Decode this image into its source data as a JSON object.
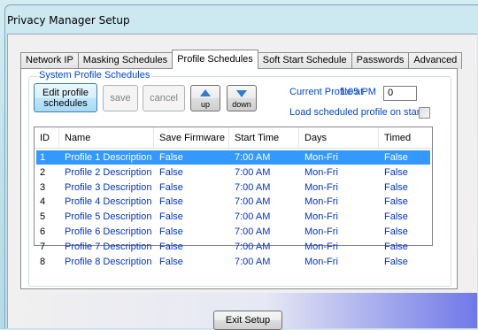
{
  "window": {
    "title": "Privacy Manager Setup"
  },
  "tabs": [
    {
      "label": "Network IP",
      "active": false
    },
    {
      "label": "Masking Schedules",
      "active": false
    },
    {
      "label": "Profile Schedules",
      "active": true
    },
    {
      "label": "Soft Start Schedule",
      "active": false
    },
    {
      "label": "Passwords",
      "active": false
    },
    {
      "label": "Advanced",
      "active": false
    }
  ],
  "group": {
    "title": "System Profile Schedules"
  },
  "buttons": {
    "edit_line1": "Edit profile",
    "edit_line2": "schedules",
    "save": "save",
    "cancel": "cancel",
    "up": "up",
    "down": "down",
    "exit": "Exit Setup"
  },
  "current_profile": {
    "label": "Current Profile at",
    "time": "1:05 PM",
    "value": "0"
  },
  "load_on_start": {
    "label": "Load scheduled profile on start.",
    "checked": false
  },
  "grid": {
    "columns": [
      "ID",
      "Name",
      "Save Firmware",
      "Start Time",
      "Days",
      "Timed"
    ],
    "rows": [
      [
        "1",
        "Profile 1 Description",
        "False",
        "7:00 AM",
        "Mon-Fri",
        "False"
      ],
      [
        "2",
        "Profile 2 Description",
        "False",
        "7:00 AM",
        "Mon-Fri",
        "False"
      ],
      [
        "3",
        "Profile 3 Description",
        "False",
        "7:00 AM",
        "Mon-Fri",
        "False"
      ],
      [
        "4",
        "Profile 4 Description",
        "False",
        "7:00 AM",
        "Mon-Fri",
        "False"
      ],
      [
        "5",
        "Profile 5 Description",
        "False",
        "7:00 AM",
        "Mon-Fri",
        "False"
      ],
      [
        "6",
        "Profile 6 Description",
        "False",
        "7:00 AM",
        "Mon-Fri",
        "False"
      ],
      [
        "7",
        "Profile 7 Description",
        "False",
        "7:00 AM",
        "Mon-Fri",
        "False"
      ],
      [
        "8",
        "Profile 8 Description",
        "False",
        "7:00 AM",
        "Mon-Fri",
        "False"
      ]
    ],
    "selected_row": 0
  },
  "colors": {
    "accent": "#0046d5",
    "selection": "#3399ff",
    "data_text": "#0033cc"
  }
}
